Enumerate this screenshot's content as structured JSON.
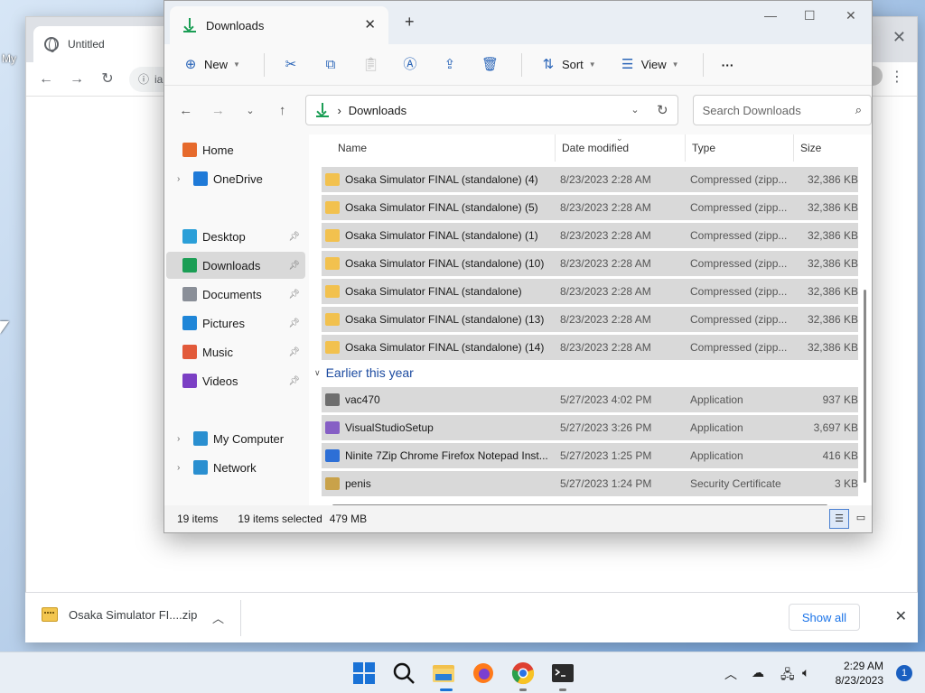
{
  "desktop": {
    "label": "My"
  },
  "browser": {
    "tab_title": "Untitled",
    "omnibox_text": "ia"
  },
  "download_shelf": {
    "file_label": "Osaka Simulator FI....zip",
    "show_all": "Show all"
  },
  "explorer": {
    "tab_title": "Downloads",
    "commands": {
      "new": "New",
      "sort": "Sort",
      "view": "View",
      "more": "···"
    },
    "address": {
      "crumb_sep": "›",
      "location": "Downloads"
    },
    "search_placeholder": "Search Downloads",
    "nav": [
      {
        "label": "Home",
        "icon": "home-icon",
        "color": "#e66a2c",
        "expandable": false,
        "pinned": false,
        "selected": false
      },
      {
        "label": "OneDrive",
        "icon": "cloud-icon",
        "color": "#1f7ad8",
        "expandable": true,
        "pinned": false,
        "selected": false
      },
      {
        "label": "Desktop",
        "icon": "desktop-icon",
        "color": "#2b9fd8",
        "expandable": false,
        "pinned": true,
        "selected": false
      },
      {
        "label": "Downloads",
        "icon": "download-icon",
        "color": "#1b9e55",
        "expandable": false,
        "pinned": true,
        "selected": true
      },
      {
        "label": "Documents",
        "icon": "documents-icon",
        "color": "#8a8f98",
        "expandable": false,
        "pinned": true,
        "selected": false
      },
      {
        "label": "Pictures",
        "icon": "pictures-icon",
        "color": "#1f86d8",
        "expandable": false,
        "pinned": true,
        "selected": false
      },
      {
        "label": "Music",
        "icon": "music-icon",
        "color": "#e25a3a",
        "expandable": false,
        "pinned": true,
        "selected": false
      },
      {
        "label": "Videos",
        "icon": "videos-icon",
        "color": "#7b3fc4",
        "expandable": false,
        "pinned": true,
        "selected": false
      },
      {
        "label": "My Computer",
        "icon": "computer-icon",
        "color": "#2a8fd0",
        "expandable": true,
        "pinned": false,
        "selected": false
      },
      {
        "label": "Network",
        "icon": "network-icon",
        "color": "#2a8fd0",
        "expandable": true,
        "pinned": false,
        "selected": false
      }
    ],
    "columns": {
      "name": "Name",
      "date": "Date modified",
      "type": "Type",
      "size": "Size"
    },
    "files_group1": [
      {
        "name": "Osaka Simulator FINAL (standalone) (4)",
        "date": "8/23/2023 2:28 AM",
        "type": "Compressed (zipp...",
        "size": "32,386 KB",
        "icon": "zip-folder-icon"
      },
      {
        "name": "Osaka Simulator FINAL (standalone) (5)",
        "date": "8/23/2023 2:28 AM",
        "type": "Compressed (zipp...",
        "size": "32,386 KB",
        "icon": "zip-folder-icon"
      },
      {
        "name": "Osaka Simulator FINAL (standalone) (1)",
        "date": "8/23/2023 2:28 AM",
        "type": "Compressed (zipp...",
        "size": "32,386 KB",
        "icon": "zip-folder-icon"
      },
      {
        "name": "Osaka Simulator FINAL (standalone) (10)",
        "date": "8/23/2023 2:28 AM",
        "type": "Compressed (zipp...",
        "size": "32,386 KB",
        "icon": "zip-folder-icon"
      },
      {
        "name": "Osaka Simulator FINAL (standalone)",
        "date": "8/23/2023 2:28 AM",
        "type": "Compressed (zipp...",
        "size": "32,386 KB",
        "icon": "zip-folder-icon"
      },
      {
        "name": "Osaka Simulator FINAL (standalone) (13)",
        "date": "8/23/2023 2:28 AM",
        "type": "Compressed (zipp...",
        "size": "32,386 KB",
        "icon": "zip-folder-icon"
      },
      {
        "name": "Osaka Simulator FINAL (standalone) (14)",
        "date": "8/23/2023 2:28 AM",
        "type": "Compressed (zipp...",
        "size": "32,386 KB",
        "icon": "zip-folder-icon"
      }
    ],
    "group2_title": "Earlier this year",
    "files_group2": [
      {
        "name": "vac470",
        "date": "5/27/2023 4:02 PM",
        "type": "Application",
        "size": "937 KB",
        "icon": "application-icon"
      },
      {
        "name": "VisualStudioSetup",
        "date": "5/27/2023 3:26 PM",
        "type": "Application",
        "size": "3,697 KB",
        "icon": "visual-studio-icon"
      },
      {
        "name": "Ninite 7Zip Chrome Firefox Notepad Inst...",
        "date": "5/27/2023 1:25 PM",
        "type": "Application",
        "size": "416 KB",
        "icon": "ninite-icon"
      },
      {
        "name": "penis",
        "date": "5/27/2023 1:24 PM",
        "type": "Security Certificate",
        "size": "3 KB",
        "icon": "certificate-icon"
      }
    ],
    "status": {
      "item_count": "19 items",
      "selected": "19 items selected",
      "size": "479 MB"
    }
  },
  "taskbar": {
    "time": "2:29 AM",
    "date": "8/23/2023",
    "notifications": "1"
  }
}
